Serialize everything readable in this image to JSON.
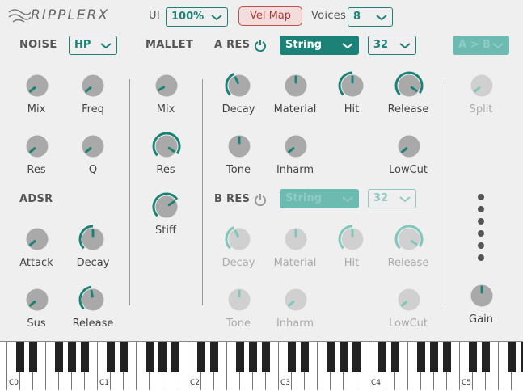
{
  "header": {
    "logo": "RIPPLERX",
    "ui_label": "UI",
    "ui_value": "100%",
    "vel_map_label": "Vel Map",
    "voices_label": "Voices",
    "voices_value": "8"
  },
  "noise": {
    "section_label": "NOISE",
    "filter_type": "HP",
    "knobs": {
      "mix": "Mix",
      "freq": "Freq",
      "res": "Res",
      "q": "Q"
    }
  },
  "adsr": {
    "section_label": "ADSR",
    "knobs": {
      "attack": "Attack",
      "decay": "Decay",
      "sus": "Sus",
      "release": "Release"
    }
  },
  "mallet": {
    "section_label": "MALLET",
    "knobs": {
      "mix": "Mix",
      "res": "Res",
      "stiff": "Stiff"
    }
  },
  "a_res": {
    "section_label": "A RES",
    "model": "String",
    "partials": "32",
    "knobs": {
      "decay": "Decay",
      "material": "Material",
      "hit": "Hit",
      "release": "Release",
      "tone": "Tone",
      "inharm": "Inharm",
      "lowcut": "LowCut"
    }
  },
  "b_res": {
    "section_label": "B RES",
    "model": "String",
    "partials": "32",
    "knobs": {
      "decay": "Decay",
      "material": "Material",
      "hit": "Hit",
      "release": "Release",
      "tone": "Tone",
      "inharm": "Inharm",
      "lowcut": "LowCut"
    }
  },
  "couple": {
    "mode": "A > B",
    "split_label": "Split",
    "gain_label": "Gain"
  },
  "keyboard": {
    "octave_labels": [
      "C0",
      "C1",
      "C2",
      "C3",
      "C4",
      "C5"
    ]
  },
  "colors": {
    "accent": "#1c8277",
    "accent_light": "#7fc6bd",
    "knob": "#a9a9a9"
  }
}
